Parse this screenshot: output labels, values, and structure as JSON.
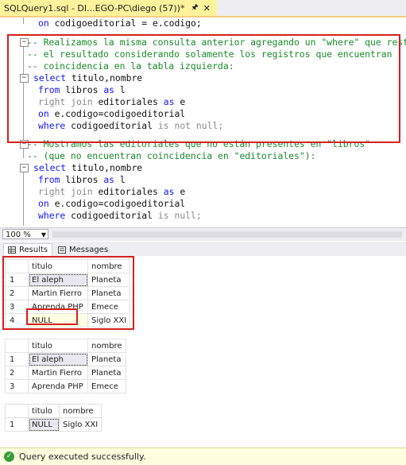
{
  "tab": {
    "title": "SQLQuery1.sql - DI...EGO-PC\\diego (57))*",
    "pin_icon": "pin-icon",
    "close_icon": "close-icon"
  },
  "editor": {
    "line0": {
      "kw": "on",
      "rest": " codigoeditorial = e.codigo;"
    },
    "block1": {
      "c1": "-- Realizamos la misma consulta anterior agregando un \"where\" que restringa",
      "c2": "-- el resultado considerando solamente los registros que encuentran",
      "c3": "-- coincidencia en la tabla izquierda:",
      "select_kw": "select",
      "select_rest": " titulo,nombre",
      "from_kw": "from",
      "from_mid": " libros ",
      "as_kw": "as",
      "from_alias": " l",
      "right_kw": "right",
      "join_kw": "join",
      "join_mid": " editoriales ",
      "join_as": "as",
      "join_alias": " e",
      "on_kw": "on",
      "on_rest": " e.codigo=codigoeditorial",
      "where_kw": "where",
      "where_mid": " codigoeditorial ",
      "is_kw": "is",
      "not_kw": "not",
      "null_kw": "null",
      "semi": ";"
    },
    "block2": {
      "c1": "-- Mostramos las editoriales que no están presentes en \"libros\"",
      "c2": "-- (que no encuentran coincidencia en \"editoriales\"):",
      "select_kw": "select",
      "select_rest": " titulo,nombre",
      "from_kw": "from",
      "from_mid": " libros ",
      "as_kw": "as",
      "from_alias": " l",
      "right_kw": "right",
      "join_kw": "join",
      "join_mid": " editoriales ",
      "join_as": "as",
      "join_alias": " e",
      "on_kw": "on",
      "on_rest": " e.codigo=codigoeditorial",
      "where_kw": "where",
      "where_mid": " codigoeditorial ",
      "is_kw": "is",
      "null_kw": "null",
      "semi": ";"
    }
  },
  "zoom": {
    "value": "100 %"
  },
  "results_tabs": [
    {
      "label": "Results",
      "icon": "grid-icon"
    },
    {
      "label": "Messages",
      "icon": "messages-icon"
    }
  ],
  "grids": [
    {
      "headers": [
        "titulo",
        "nombre"
      ],
      "rows": [
        {
          "n": "1",
          "titulo": "El aleph",
          "nombre": "Planeta"
        },
        {
          "n": "2",
          "titulo": "Martin Fierro",
          "nombre": "Planeta"
        },
        {
          "n": "3",
          "titulo": "Aprenda PHP",
          "nombre": "Emece"
        },
        {
          "n": "4",
          "titulo": "NULL",
          "nombre": "Siglo XXI"
        }
      ]
    },
    {
      "headers": [
        "titulo",
        "nombre"
      ],
      "rows": [
        {
          "n": "1",
          "titulo": "El aleph",
          "nombre": "Planeta"
        },
        {
          "n": "2",
          "titulo": "Martin Fierro",
          "nombre": "Planeta"
        },
        {
          "n": "3",
          "titulo": "Aprenda PHP",
          "nombre": "Emece"
        }
      ]
    },
    {
      "headers": [
        "titulo",
        "nombre"
      ],
      "rows": [
        {
          "n": "1",
          "titulo": "NULL",
          "nombre": "Siglo XXI"
        }
      ]
    }
  ],
  "status": {
    "text": "Query executed successfully.",
    "icon": "check-circle-icon",
    "color": "#ffffe0"
  }
}
